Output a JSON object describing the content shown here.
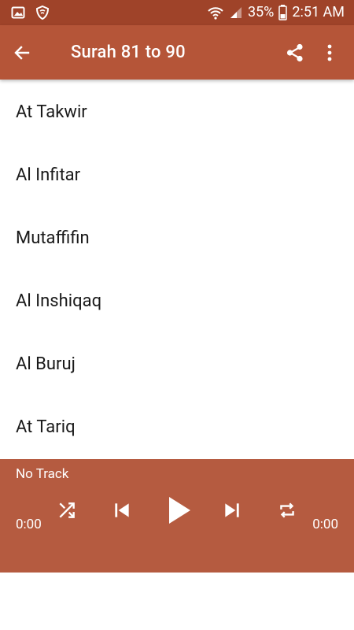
{
  "status_bar": {
    "battery": "35%",
    "time": "2:51 AM"
  },
  "app_bar": {
    "title": "Surah 81 to 90"
  },
  "list": {
    "items": [
      {
        "label": "At Takwir"
      },
      {
        "label": "Al Infitar"
      },
      {
        "label": "Mutaffifin"
      },
      {
        "label": "Al Inshiqaq"
      },
      {
        "label": "Al Buruj"
      },
      {
        "label": "At Tariq"
      }
    ]
  },
  "player": {
    "track": "No Track",
    "elapsed": "0:00",
    "duration": "0:00"
  },
  "colors": {
    "status_bar": "#9f4329",
    "app_bar": "#b55538",
    "player": "#b55b40",
    "icon": "#ffffff",
    "text": "#1a1a1a"
  }
}
